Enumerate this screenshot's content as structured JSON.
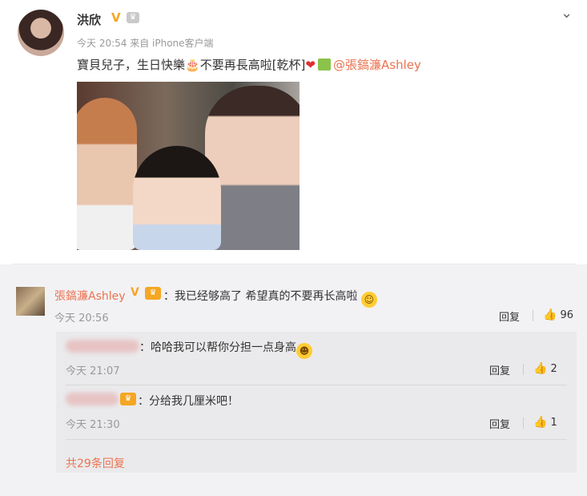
{
  "post": {
    "author": "洪欣",
    "verified_badge": "V",
    "meta": "今天 20:54 来自 iPhone客户端",
    "text_main": "寶貝兒子，生日快樂",
    "text_tail": "不要再長高啦[乾杯]",
    "mention": "@張鎬濂Ashley",
    "icons": [
      "cake-icon",
      "heart-icon",
      "gift-icon",
      "chevron-down-icon"
    ]
  },
  "comment": {
    "author": "張鎬濂Ashley",
    "verified_badge": "V",
    "text": "：我已经够高了 希望真的不要再长高啦",
    "time": "今天 20:56",
    "reply_label": "回复",
    "likes": "96"
  },
  "replies": [
    {
      "text": "：哈哈我可以帮你分担一点身高",
      "time": "今天 21:07",
      "reply_label": "回复",
      "likes": "2"
    },
    {
      "text": "：分给我几厘米吧！",
      "time": "今天 21:30",
      "reply_label": "回复",
      "likes": "1"
    }
  ],
  "more_replies": "共29条回复",
  "colors": {
    "accent": "#eb7350",
    "verified": "#f5a623",
    "panel": "#f2f2f5"
  }
}
